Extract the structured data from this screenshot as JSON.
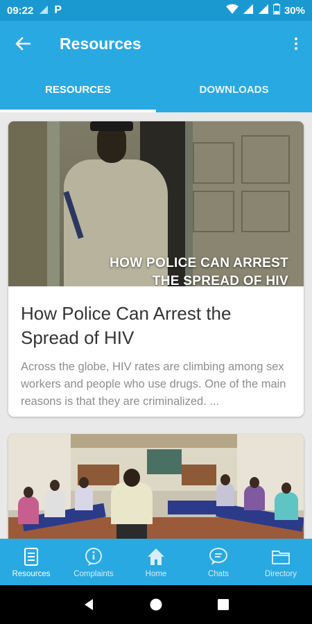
{
  "status_bar": {
    "time": "09:22",
    "signal_label": "3G",
    "p_icon": "parking-p-icon",
    "battery": "30%"
  },
  "app_bar": {
    "title": "Resources",
    "back_icon": "arrow-left-icon",
    "menu_icon": "more-vertical-icon"
  },
  "tabs": [
    {
      "label": "RESOURCES",
      "active": true
    },
    {
      "label": "DOWNLOADS",
      "active": false
    }
  ],
  "cards": [
    {
      "image_overlay_line1": "HOW POLICE CAN ARREST",
      "image_overlay_line2": "THE SPREAD OF HIV",
      "title": "How Police Can Arrest the Spread of HIV",
      "description": "Across the globe, HIV rates are climbing among sex workers and people who use drugs. One of the main reasons is that they are criminalized. ..."
    }
  ],
  "bottom_nav": [
    {
      "label": "Resources",
      "icon": "document-icon",
      "active": true
    },
    {
      "label": "Complaints",
      "icon": "info-bubble-icon",
      "active": false
    },
    {
      "label": "Home",
      "icon": "home-icon",
      "active": false
    },
    {
      "label": "Chats",
      "icon": "chat-bubble-icon",
      "active": false
    },
    {
      "label": "Directory",
      "icon": "folder-icon",
      "active": false
    }
  ],
  "colors": {
    "primary": "#29a9e1",
    "status_bar": "#1a99d1",
    "background": "#e9e9e9"
  }
}
